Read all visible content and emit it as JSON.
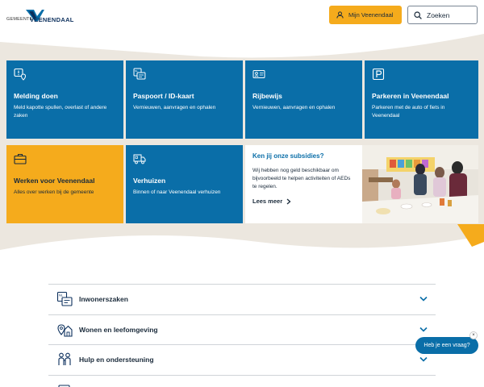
{
  "header": {
    "logo_prefix": "GEMEENTE",
    "logo_name": "VEENENDAAL",
    "account_button": "Mijn Veenendaal",
    "search_placeholder": "Zoeken"
  },
  "tiles": [
    {
      "title": "Melding doen",
      "subtitle": "Meld kapotte spullen, overlast of andere zaken",
      "icon": "report-pin-icon"
    },
    {
      "title": "Paspoort / ID-kaart",
      "subtitle": "Vernieuwen, aanvragen en ophalen",
      "icon": "id-card-icon"
    },
    {
      "title": "Rijbewijs",
      "subtitle": "Vernieuwen, aanvragen en ophalen",
      "icon": "license-icon"
    },
    {
      "title": "Parkeren in Veenendaal",
      "subtitle": "Parkeren met de auto of fiets in Veenendaal",
      "icon": "parking-icon"
    },
    {
      "title": "Werken voor Veenendaal",
      "subtitle": "Alles over werken bij de gemeente",
      "icon": "briefcase-icon"
    },
    {
      "title": "Verhuizen",
      "subtitle": "Binnen of naar Veenendaal verhuizen",
      "icon": "moving-truck-icon"
    }
  ],
  "subsidy": {
    "title": "Ken jij onze subsidies?",
    "body": "Wij hebben nog geld beschikbaar om bijvoorbeeld te helpen activiteiten of AEDs te regelen.",
    "link": "Lees meer"
  },
  "accordion": [
    {
      "label": "Inwonerszaken",
      "icon": "id-card-icon"
    },
    {
      "label": "Wonen en leefomgeving",
      "icon": "house-pin-icon"
    },
    {
      "label": "Hulp en ondersteuning",
      "icon": "people-icon"
    },
    {
      "label": "",
      "icon": "document-icon"
    }
  ],
  "chat": {
    "label": "Heb je een vraag?",
    "close": "×"
  },
  "colors": {
    "primary_blue": "#0a6ea8",
    "accent_orange": "#f5ab1c",
    "navy": "#0b2f5c",
    "beige": "#ece7df"
  }
}
